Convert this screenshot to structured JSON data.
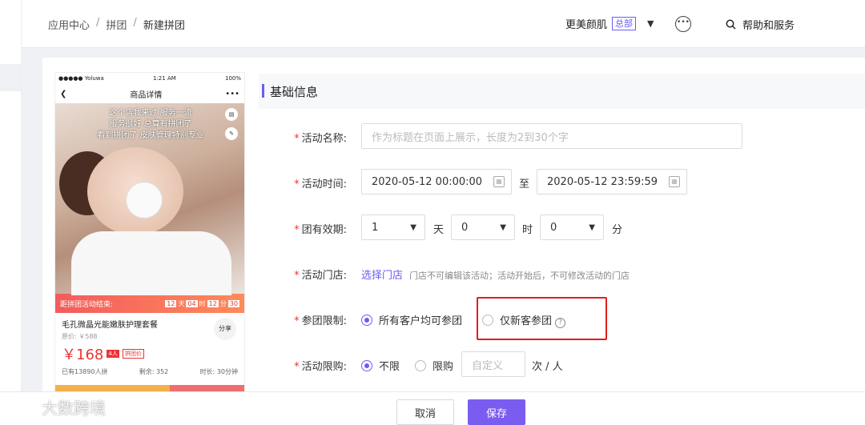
{
  "breadcrumb": {
    "items": [
      "应用中心",
      "拼团",
      "新建拼团"
    ],
    "sep": "/"
  },
  "header": {
    "store_name": "更美颜肌",
    "store_badge": "总部",
    "help_label": "帮助和服务"
  },
  "phone": {
    "carrier": "●●●●● Yoluwa  ",
    "time": "1:21 AM",
    "battery": "100%",
    "nav_title": "商品详情",
    "nav_more": "•••",
    "slogan_lines": [
      "这个店我来过 服务一流",
      "服务很好  总算有拼团了",
      "看到拼团了 皮肤管理特别专业"
    ],
    "banner_label": "距拼团活动结束:",
    "countdown": [
      "12",
      "04",
      "12",
      "30"
    ],
    "countdown_units": [
      "天",
      "时",
      "分"
    ],
    "product_title": "毛孔微晶光能嫩肤护理套餐",
    "orig_price": "原价: ￥588",
    "price": "￥168",
    "tag1": "4人",
    "tag2": "拼团价",
    "stat_sold": "已有13890人拼",
    "stat_left": "剩余: 352",
    "stat_time": "时长: 30分钟",
    "share_label": "分享"
  },
  "section": {
    "title": "基础信息"
  },
  "form": {
    "name": {
      "label": "活动名称:",
      "placeholder": "作为标题在页面上展示，长度为2到30个字"
    },
    "time": {
      "label": "活动时间:",
      "start": "2020-05-12 00:00:00",
      "to": "至",
      "end": "2020-05-12 23:59:59"
    },
    "validity": {
      "label": "团有效期:",
      "day_value": "1",
      "day_unit": "天",
      "hour_value": "0",
      "hour_unit": "时",
      "min_value": "0",
      "min_unit": "分"
    },
    "store": {
      "label": "活动门店:",
      "link": "选择门店",
      "hint": "门店不可编辑该活动；活动开始后，不可修改活动的门店"
    },
    "limit": {
      "label": "参团限制:",
      "opt_all": "所有客户均可参团",
      "opt_new": "仅新客参团"
    },
    "purchase": {
      "label": "活动限购:",
      "opt_none": "不限",
      "opt_limit": "限购",
      "custom_placeholder": "自定义",
      "unit": "次 / 人"
    }
  },
  "footer": {
    "cancel": "取消",
    "save": "保存"
  },
  "watermark": "大数跨境",
  "colors": {
    "accent": "#6a5cf6",
    "danger": "#e01e1e",
    "save_btn": "#7b5cf0"
  }
}
